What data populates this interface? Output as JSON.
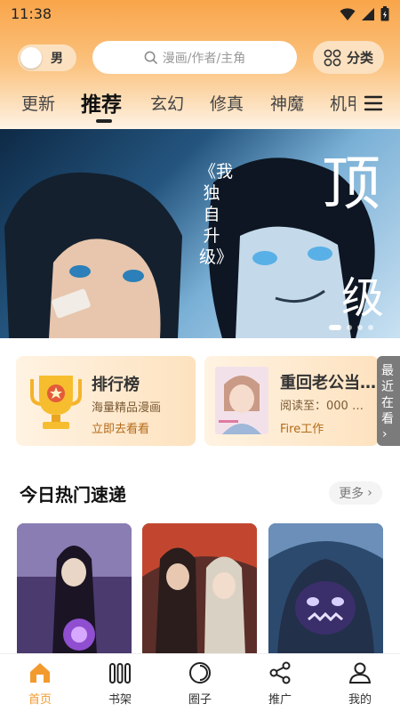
{
  "status_bar": {
    "time": "11:38"
  },
  "header": {
    "gender_label": "男",
    "search_placeholder": "漫画/作者/主角",
    "category_label": "分类"
  },
  "tabs": [
    {
      "label": "更新",
      "active": false
    },
    {
      "label": "推荐",
      "active": true
    },
    {
      "label": "玄幻",
      "active": false
    },
    {
      "label": "修真",
      "active": false
    },
    {
      "label": "神魔",
      "active": false
    },
    {
      "label": "机甲",
      "active": false
    }
  ],
  "banner": {
    "title_main": "顶",
    "title_sub": "级",
    "vertical_text": "《我独自升级》"
  },
  "promo_cards": {
    "ranking": {
      "title": "排行榜",
      "subtitle": "海量精品漫画",
      "action": "立即去看看"
    },
    "recent": {
      "title": "重回老公当…",
      "progress": "阅读至：000 …",
      "studio": "Fire工作"
    }
  },
  "recent_side": {
    "label": "最近在看",
    "arrow": "›"
  },
  "hot_section": {
    "title": "今日热门速递",
    "more_label": "更多",
    "more_arrow": "›"
  },
  "bottom_nav": [
    {
      "label": "首页",
      "icon": "home-icon",
      "active": true
    },
    {
      "label": "书架",
      "icon": "bookshelf-icon",
      "active": false
    },
    {
      "label": "圈子",
      "icon": "circle-icon",
      "active": false
    },
    {
      "label": "推广",
      "icon": "share-icon",
      "active": false
    },
    {
      "label": "我的",
      "icon": "profile-icon",
      "active": false
    }
  ],
  "colors": {
    "accent": "#f39a2e",
    "header_top": "#f9a54a"
  }
}
